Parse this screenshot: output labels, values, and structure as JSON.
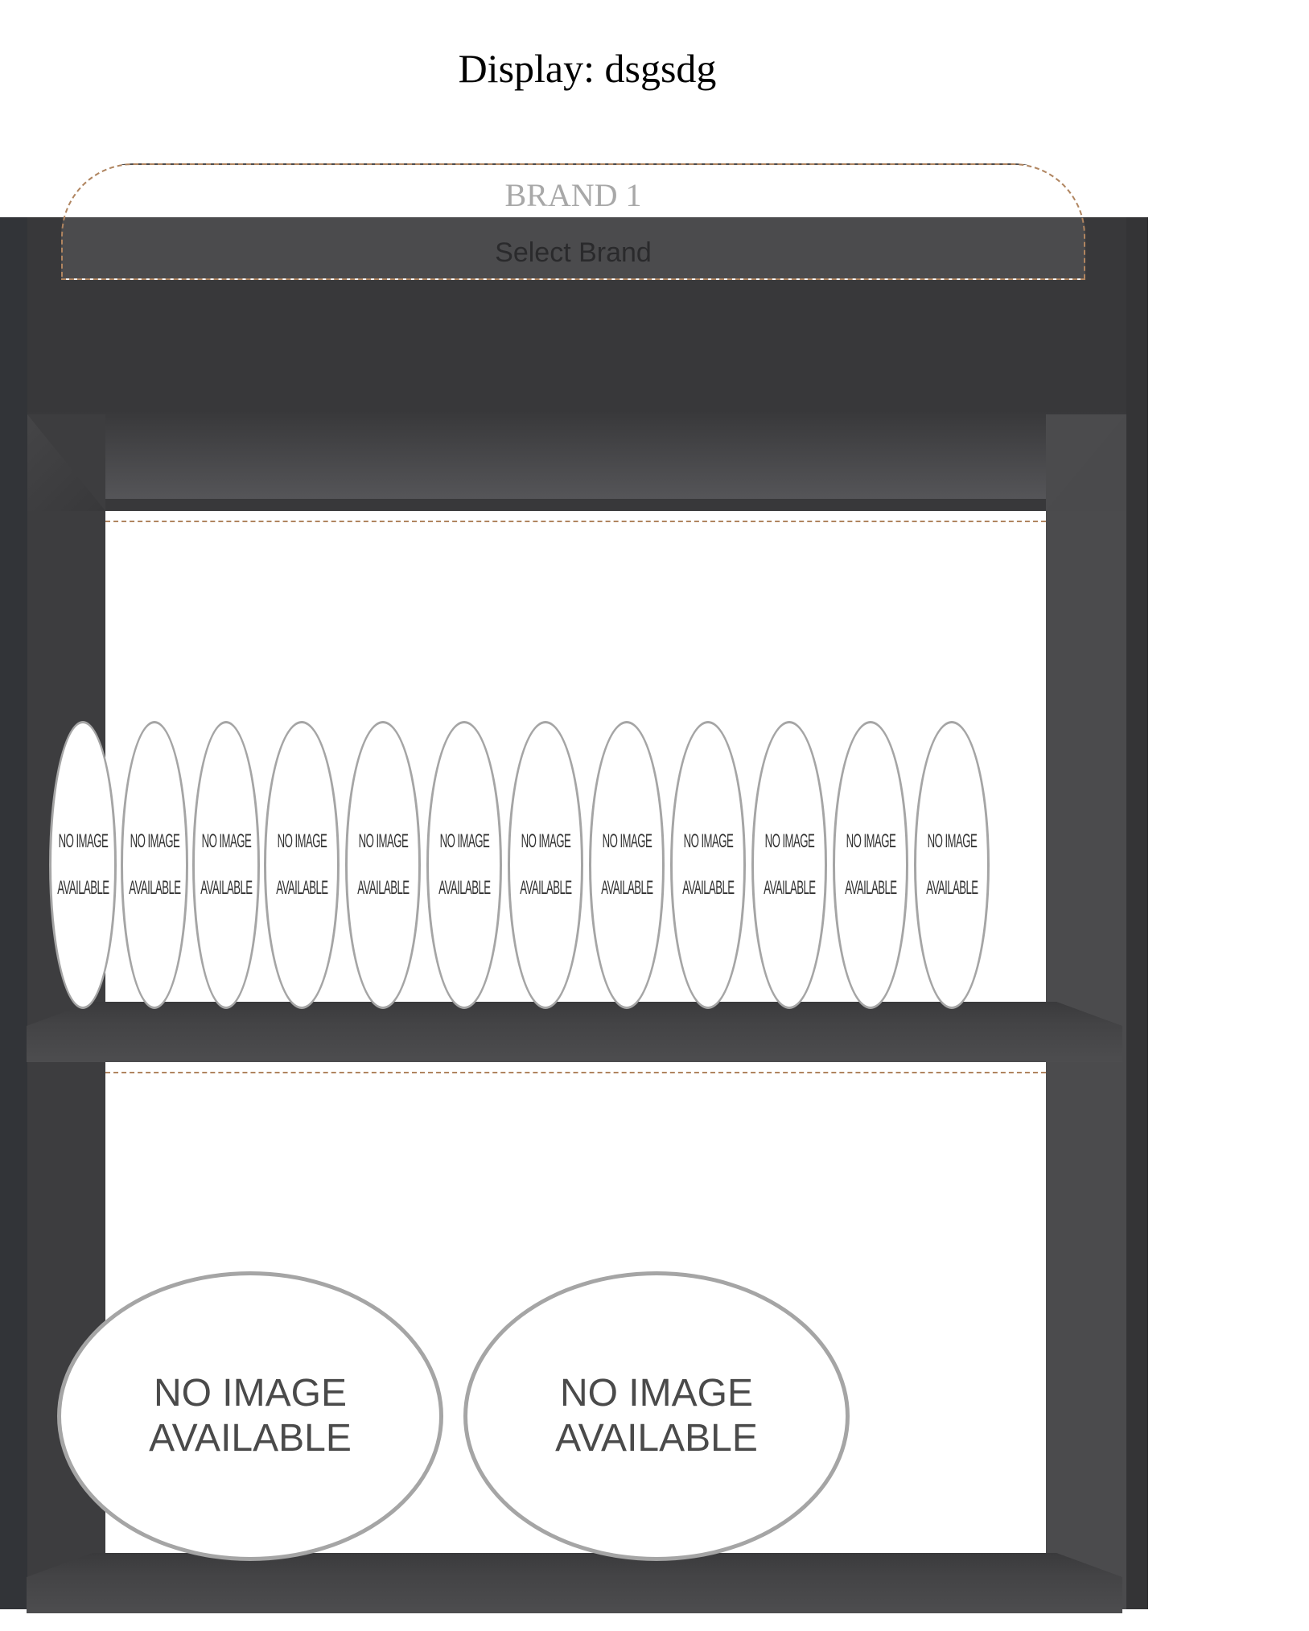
{
  "display": {
    "title": "Display: dsgsdg"
  },
  "brand_header": {
    "brand_name": "BRAND 1",
    "select_label": "Select Brand"
  },
  "shelves": [
    {
      "products": [
        {
          "label": "NO IMAGE\nAVAILABLE"
        },
        {
          "label": "NO IMAGE\nAVAILABLE"
        },
        {
          "label": "NO IMAGE\nAVAILABLE"
        },
        {
          "label": "NO IMAGE\nAVAILABLE"
        },
        {
          "label": "NO IMAGE\nAVAILABLE"
        },
        {
          "label": "NO IMAGE\nAVAILABLE"
        },
        {
          "label": "NO IMAGE\nAVAILABLE"
        },
        {
          "label": "NO IMAGE\nAVAILABLE"
        },
        {
          "label": "NO IMAGE\nAVAILABLE"
        },
        {
          "label": "NO IMAGE\nAVAILABLE"
        },
        {
          "label": "NO IMAGE\nAVAILABLE"
        },
        {
          "label": "NO IMAGE\nAVAILABLE"
        }
      ]
    },
    {
      "products": [
        {
          "label": "NO IMAGE\nAVAILABLE"
        },
        {
          "label": "NO IMAGE\nAVAILABLE"
        }
      ]
    }
  ],
  "colors": {
    "cabinet": "#38383a",
    "shelf_guide": "#b08560",
    "placeholder_border": "#a5a5a5"
  }
}
